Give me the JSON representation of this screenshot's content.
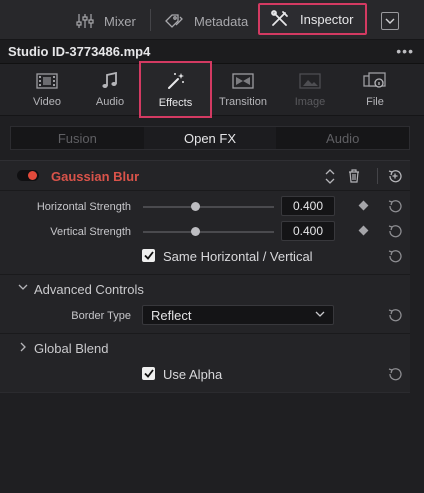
{
  "toolbar": {
    "mixer_label": "Mixer",
    "metadata_label": "Metadata",
    "inspector_label": "Inspector"
  },
  "clip": {
    "filename": "Studio ID-3773486.mp4",
    "more": "•••"
  },
  "categories": [
    {
      "label": "Video",
      "icon": "film-icon",
      "state": "normal"
    },
    {
      "label": "Audio",
      "icon": "music-note-icon",
      "state": "normal"
    },
    {
      "label": "Effects",
      "icon": "magic-wand-icon",
      "state": "active"
    },
    {
      "label": "Transition",
      "icon": "transition-icon",
      "state": "normal"
    },
    {
      "label": "Image",
      "icon": "image-icon",
      "state": "disabled"
    },
    {
      "label": "File",
      "icon": "file-info-icon",
      "state": "normal"
    }
  ],
  "subtabs": [
    {
      "label": "Fusion",
      "active": false
    },
    {
      "label": "Open FX",
      "active": true
    },
    {
      "label": "Audio",
      "active": false
    }
  ],
  "effect": {
    "name": "Gaussian Blur",
    "enabled": true,
    "params": {
      "horizontal": {
        "label": "Horizontal Strength",
        "value": "0.400",
        "level": 0.4
      },
      "vertical": {
        "label": "Vertical Strength",
        "value": "0.400",
        "level": 0.4
      }
    },
    "same_hv": {
      "label": "Same Horizontal / Vertical",
      "checked": true
    },
    "advanced": {
      "label": "Advanced Controls",
      "expanded": true,
      "border_type": {
        "label": "Border Type",
        "value": "Reflect"
      }
    },
    "global_blend": {
      "label": "Global Blend",
      "expanded": false
    },
    "use_alpha": {
      "label": "Use Alpha",
      "checked": true
    }
  },
  "colors": {
    "highlight_border": "#d33a62",
    "effect_title": "#d9534a",
    "toggle_on": "#e24a3b"
  }
}
